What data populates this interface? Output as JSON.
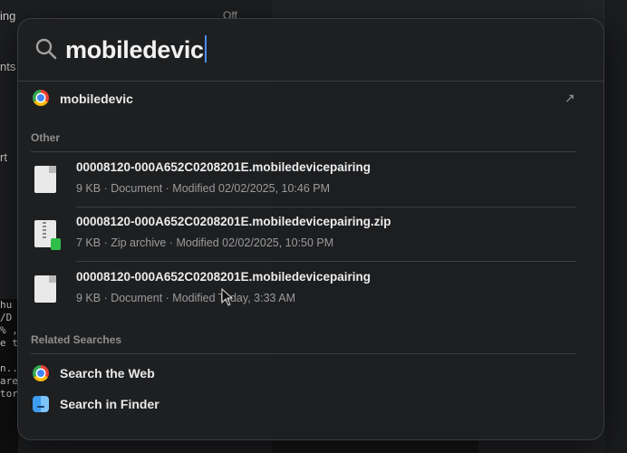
{
  "background": {
    "left_rows": [
      "ing",
      "nts",
      "rt"
    ],
    "off_label": "Off",
    "terminal_lines": [
      "hu",
      "/D",
      "% ,",
      "e t",
      "",
      "n..",
      "are",
      "tory"
    ]
  },
  "search": {
    "query": "mobiledevic"
  },
  "top_hit": {
    "label": "mobiledevic"
  },
  "sections": {
    "other": "Other",
    "related": "Related Searches"
  },
  "files": [
    {
      "name": "00008120-000A652C0208201E.mobiledevicepairing",
      "meta": "9 KB · Document · Modified 02/02/2025, 10:46 PM",
      "icon": "document-icon"
    },
    {
      "name": "00008120-000A652C0208201E.mobiledevicepairing.zip",
      "meta": "7 KB · Zip archive · Modified 02/02/2025, 10:50 PM",
      "icon": "zip-archive-icon"
    },
    {
      "name": "00008120-000A652C0208201E.mobiledevicepairing",
      "meta": "9 KB · Document · Modified Today, 3:33 AM",
      "icon": "document-icon"
    }
  ],
  "related": [
    {
      "label": "Search the Web",
      "icon": "chrome-icon"
    },
    {
      "label": "Search in Finder",
      "icon": "finder-icon"
    }
  ],
  "colors": {
    "panel_bg": "#1e1f21",
    "caret": "#4a8cf7",
    "zip_badge": "#2fbf4a"
  }
}
